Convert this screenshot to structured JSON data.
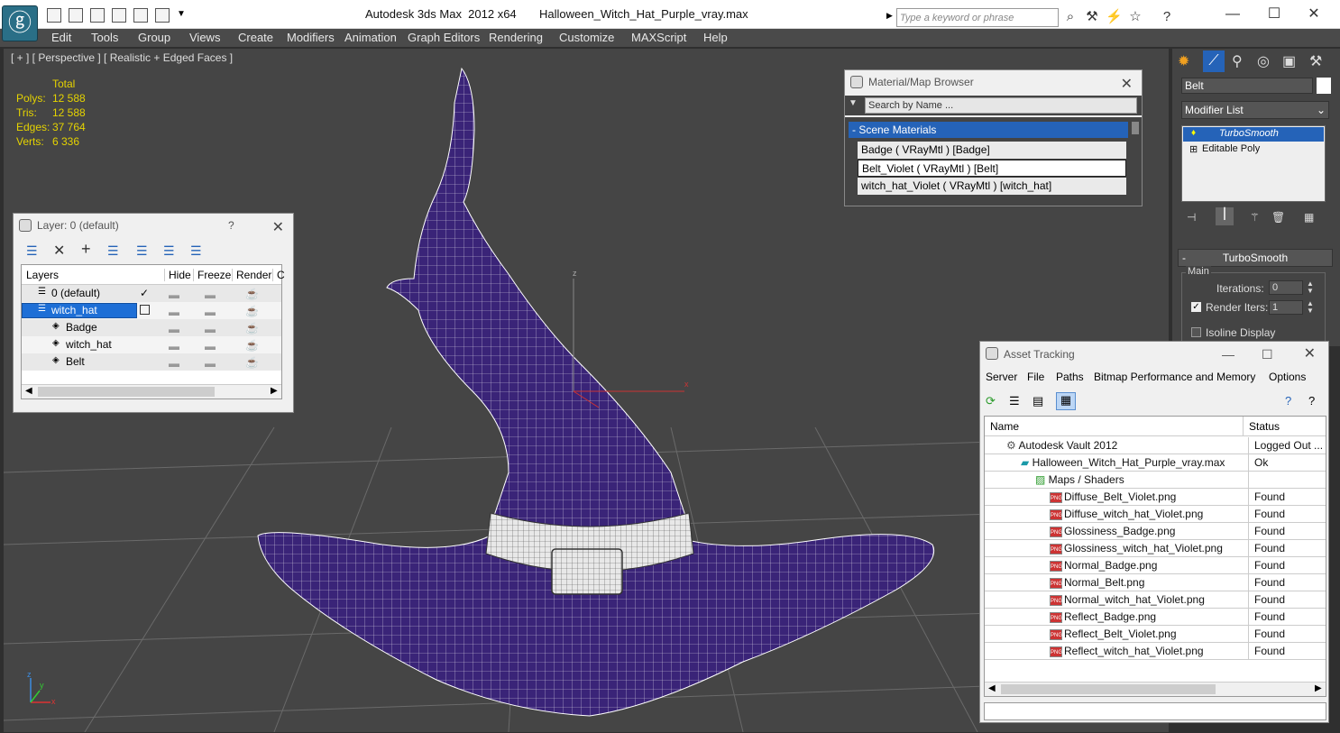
{
  "app": {
    "title": "Autodesk 3ds Max  2012 x64",
    "file": "Halloween_Witch_Hat_Purple_vray.max",
    "search_placeholder": "Type a keyword or phrase"
  },
  "menu": [
    "Edit",
    "Tools",
    "Group",
    "Views",
    "Create",
    "Modifiers",
    "Animation",
    "Graph Editors",
    "Rendering",
    "Customize",
    "MAXScript",
    "Help"
  ],
  "viewport": {
    "label": "[ + ] [ Perspective ] [ Realistic + Edged Faces ]",
    "stats": {
      "header": "Total",
      "rows": [
        {
          "k": "Polys:",
          "v": "12 588"
        },
        {
          "k": "Tris:",
          "v": "12 588"
        },
        {
          "k": "Edges:",
          "v": "37 764"
        },
        {
          "k": "Verts:",
          "v": "6 336"
        }
      ]
    },
    "colors": {
      "hat": "#3a2478",
      "wire": "#ffffff",
      "grid": "#6a6a6a",
      "stats": "#e5d300"
    },
    "axis": {
      "x": "x",
      "y": "y",
      "z": "z"
    }
  },
  "layer_panel": {
    "title": "Layer: 0 (default)",
    "help": "?",
    "columns": [
      "Layers",
      "Hide",
      "Freeze",
      "Render",
      "C"
    ],
    "rows": [
      {
        "name": "0 (default)",
        "check": "✓"
      },
      {
        "name": "witch_hat",
        "check": ""
      },
      {
        "name": "Badge",
        "check": ""
      },
      {
        "name": "witch_hat",
        "check": ""
      },
      {
        "name": "Belt",
        "check": ""
      }
    ]
  },
  "material_browser": {
    "title": "Material/Map Browser",
    "search_placeholder": "Search by Name ...",
    "section": "- Scene Materials",
    "items": [
      "Badge  ( VRayMtl )  [Badge]",
      "Belt_Violet  ( VRayMtl )  [Belt]",
      "witch_hat_Violet  ( VRayMtl )  [witch_hat]"
    ]
  },
  "command_panel": {
    "name_field": "Belt",
    "modifier_list": "Modifier List",
    "stack": [
      "TurboSmooth",
      "Editable Poly"
    ],
    "rollout": {
      "title": "TurboSmooth",
      "group": "Main",
      "iterations_label": "Iterations:",
      "iterations": "0",
      "render_iters_label": "Render Iters:",
      "render_iters": "1",
      "isoline": "Isoline Display"
    }
  },
  "asset_tracking": {
    "title": "Asset Tracking",
    "menu": [
      "Server",
      "File",
      "Paths",
      "Bitmap Performance and Memory",
      "Options"
    ],
    "columns": [
      "Name",
      "Status"
    ],
    "rows": [
      {
        "name": "Autodesk Vault 2012",
        "status": "Logged Out ...",
        "indent": 0,
        "kind": "vault"
      },
      {
        "name": "Halloween_Witch_Hat_Purple_vray.max",
        "status": "Ok",
        "indent": 1,
        "kind": "max"
      },
      {
        "name": "Maps / Shaders",
        "status": "",
        "indent": 2,
        "kind": "folder"
      },
      {
        "name": "Diffuse_Belt_Violet.png",
        "status": "Found",
        "indent": 3,
        "kind": "png"
      },
      {
        "name": "Diffuse_witch_hat_Violet.png",
        "status": "Found",
        "indent": 3,
        "kind": "png"
      },
      {
        "name": "Glossiness_Badge.png",
        "status": "Found",
        "indent": 3,
        "kind": "png"
      },
      {
        "name": "Glossiness_witch_hat_Violet.png",
        "status": "Found",
        "indent": 3,
        "kind": "png"
      },
      {
        "name": "Normal_Badge.png",
        "status": "Found",
        "indent": 3,
        "kind": "png"
      },
      {
        "name": "Normal_Belt.png",
        "status": "Found",
        "indent": 3,
        "kind": "png"
      },
      {
        "name": "Normal_witch_hat_Violet.png",
        "status": "Found",
        "indent": 3,
        "kind": "png"
      },
      {
        "name": "Reflect_Badge.png",
        "status": "Found",
        "indent": 3,
        "kind": "png"
      },
      {
        "name": "Reflect_Belt_Violet.png",
        "status": "Found",
        "indent": 3,
        "kind": "png"
      },
      {
        "name": "Reflect_witch_hat_Violet.png",
        "status": "Found",
        "indent": 3,
        "kind": "png"
      }
    ]
  }
}
